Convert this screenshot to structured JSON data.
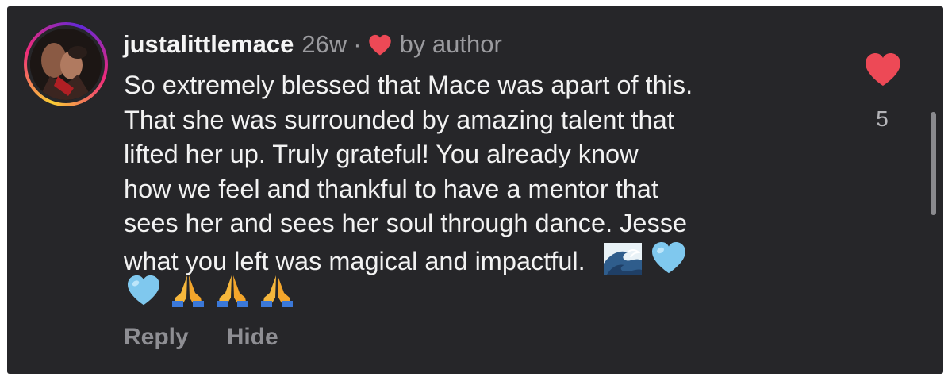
{
  "comment": {
    "username": "justalittlemace",
    "age": "26w",
    "separator": "·",
    "liked_by_author_label": "by author",
    "lines": [
      "So extremely blessed that Mace was apart of this.",
      "That she was surrounded by amazing talent that",
      "lifted her up. Truly grateful! You already know",
      "how we feel and thankful to have a mentor that",
      "sees her and sees her soul through dance. Jesse",
      "what you left was magical and impactful."
    ],
    "trailing_emojis": [
      "water-wave",
      "light-blue-heart"
    ],
    "emoji_row": [
      "light-blue-heart",
      "folded-hands",
      "folded-hands",
      "folded-hands"
    ]
  },
  "likes": {
    "count": "5"
  },
  "actions": {
    "reply_label": "Reply",
    "hide_label": "Hide"
  },
  "colors": {
    "background": "#262629",
    "text": "#f2f2f2",
    "muted": "#9b9b9f",
    "heart": "#ed4956",
    "story_ring": [
      "#f9ce34",
      "#ee2a7b",
      "#6228d7"
    ]
  }
}
